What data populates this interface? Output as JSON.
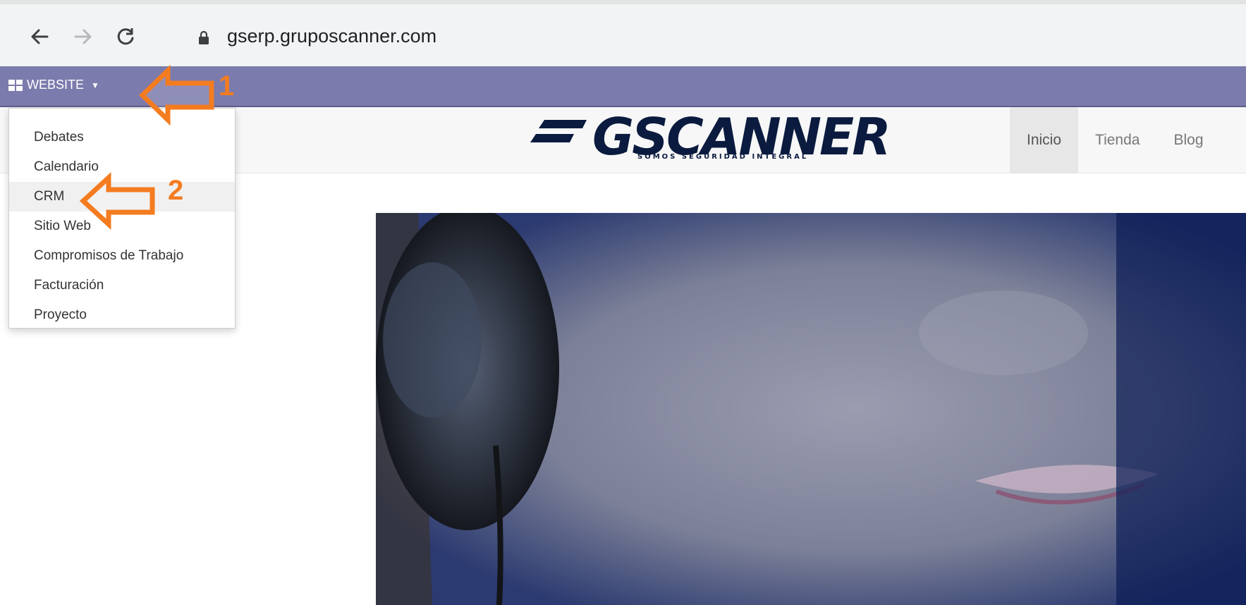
{
  "browser": {
    "url": "gserp.gruposcanner.com"
  },
  "odoo_bar": {
    "app_menu_label": "WEBSITE"
  },
  "dropdown": {
    "items": [
      {
        "label": "Debates"
      },
      {
        "label": "Calendario"
      },
      {
        "label": "CRM"
      },
      {
        "label": "Sitio Web"
      },
      {
        "label": "Compromisos de Trabajo"
      },
      {
        "label": "Facturación"
      },
      {
        "label": "Proyecto"
      }
    ]
  },
  "site": {
    "logo_text": "GSCANNER",
    "tagline": "SOMOS SEGURIDAD INTEGRAL",
    "nav": [
      {
        "label": "Inicio",
        "active": true
      },
      {
        "label": "Tienda",
        "active": false
      },
      {
        "label": "Blog",
        "active": false
      }
    ]
  },
  "annotations": {
    "step1": "1",
    "step2": "2"
  },
  "colors": {
    "odoo_bar": "#7c7bad",
    "annotation": "#f47c20",
    "logo": "#0b1b3f"
  }
}
